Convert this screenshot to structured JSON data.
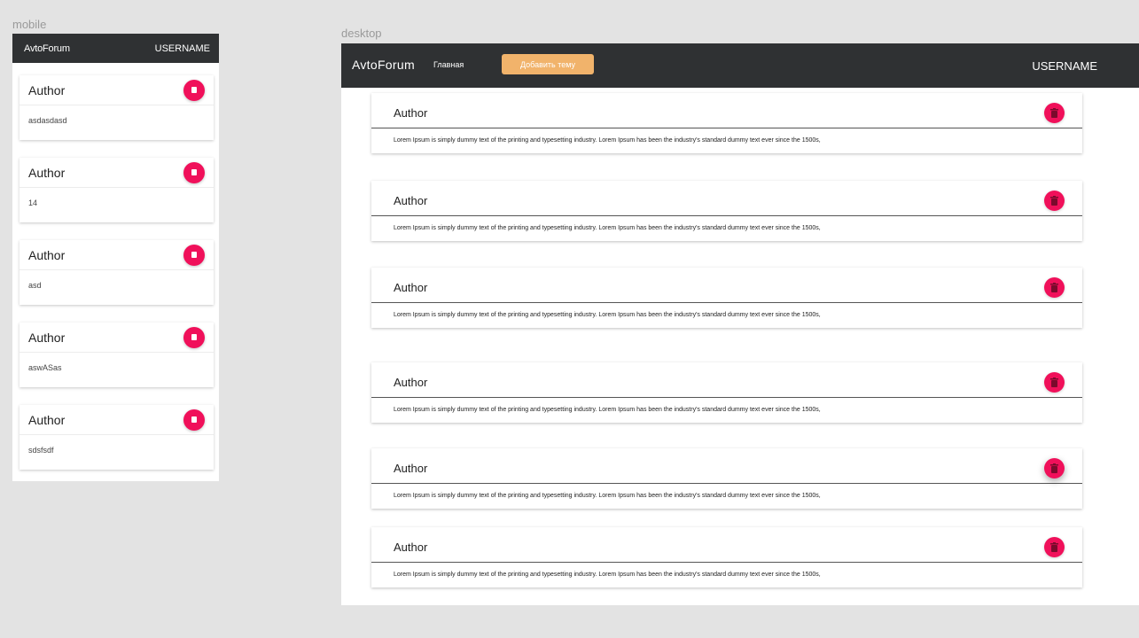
{
  "labels": {
    "mobile": "mobile",
    "desktop": "desktop"
  },
  "mobile": {
    "brand": "AvtoForum",
    "user": "USERNAME",
    "posts": [
      {
        "author": "Author",
        "text": "asdasdasd"
      },
      {
        "author": "Author",
        "text": "14"
      },
      {
        "author": "Author",
        "text": "asd"
      },
      {
        "author": "Author",
        "text": "aswASas"
      },
      {
        "author": "Author",
        "text": "sdsfsdf"
      }
    ]
  },
  "desktop": {
    "brand": "AvtoForum",
    "nav_main": "Главная",
    "add_topic": "Добавить тему",
    "user": "USERNAME",
    "posts": [
      {
        "author": "Author",
        "text": "Lorem Ipsum is simply dummy text of the printing and typesetting industry. Lorem Ipsum has been the industry's standard dummy text ever since the 1500s,"
      },
      {
        "author": "Author",
        "text": "Lorem Ipsum is simply dummy text of the printing and typesetting industry. Lorem Ipsum has been the industry's standard dummy text ever since the 1500s,"
      },
      {
        "author": "Author",
        "text": "Lorem Ipsum is simply dummy text of the printing and typesetting industry. Lorem Ipsum has been the industry's standard dummy text ever since the 1500s,"
      },
      {
        "author": "Author",
        "text": "Lorem Ipsum is simply dummy text of the printing and typesetting industry. Lorem Ipsum has been the industry's standard dummy text ever since the 1500s,"
      },
      {
        "author": "Author",
        "text": "Lorem Ipsum is simply dummy text of the printing and typesetting industry. Lorem Ipsum has been the industry's standard dummy text ever since the 1500s,"
      },
      {
        "author": "Author",
        "text": "Lorem Ipsum is simply dummy text of the printing and typesetting industry. Lorem Ipsum has been the industry's standard dummy text ever since the 1500s,"
      }
    ]
  },
  "colors": {
    "header": "#2f3133",
    "delete_button": "#f0105a",
    "add_button": "#f1b36b",
    "canvas": "#e3e3e3"
  },
  "icons": {
    "delete": "trash-icon"
  }
}
